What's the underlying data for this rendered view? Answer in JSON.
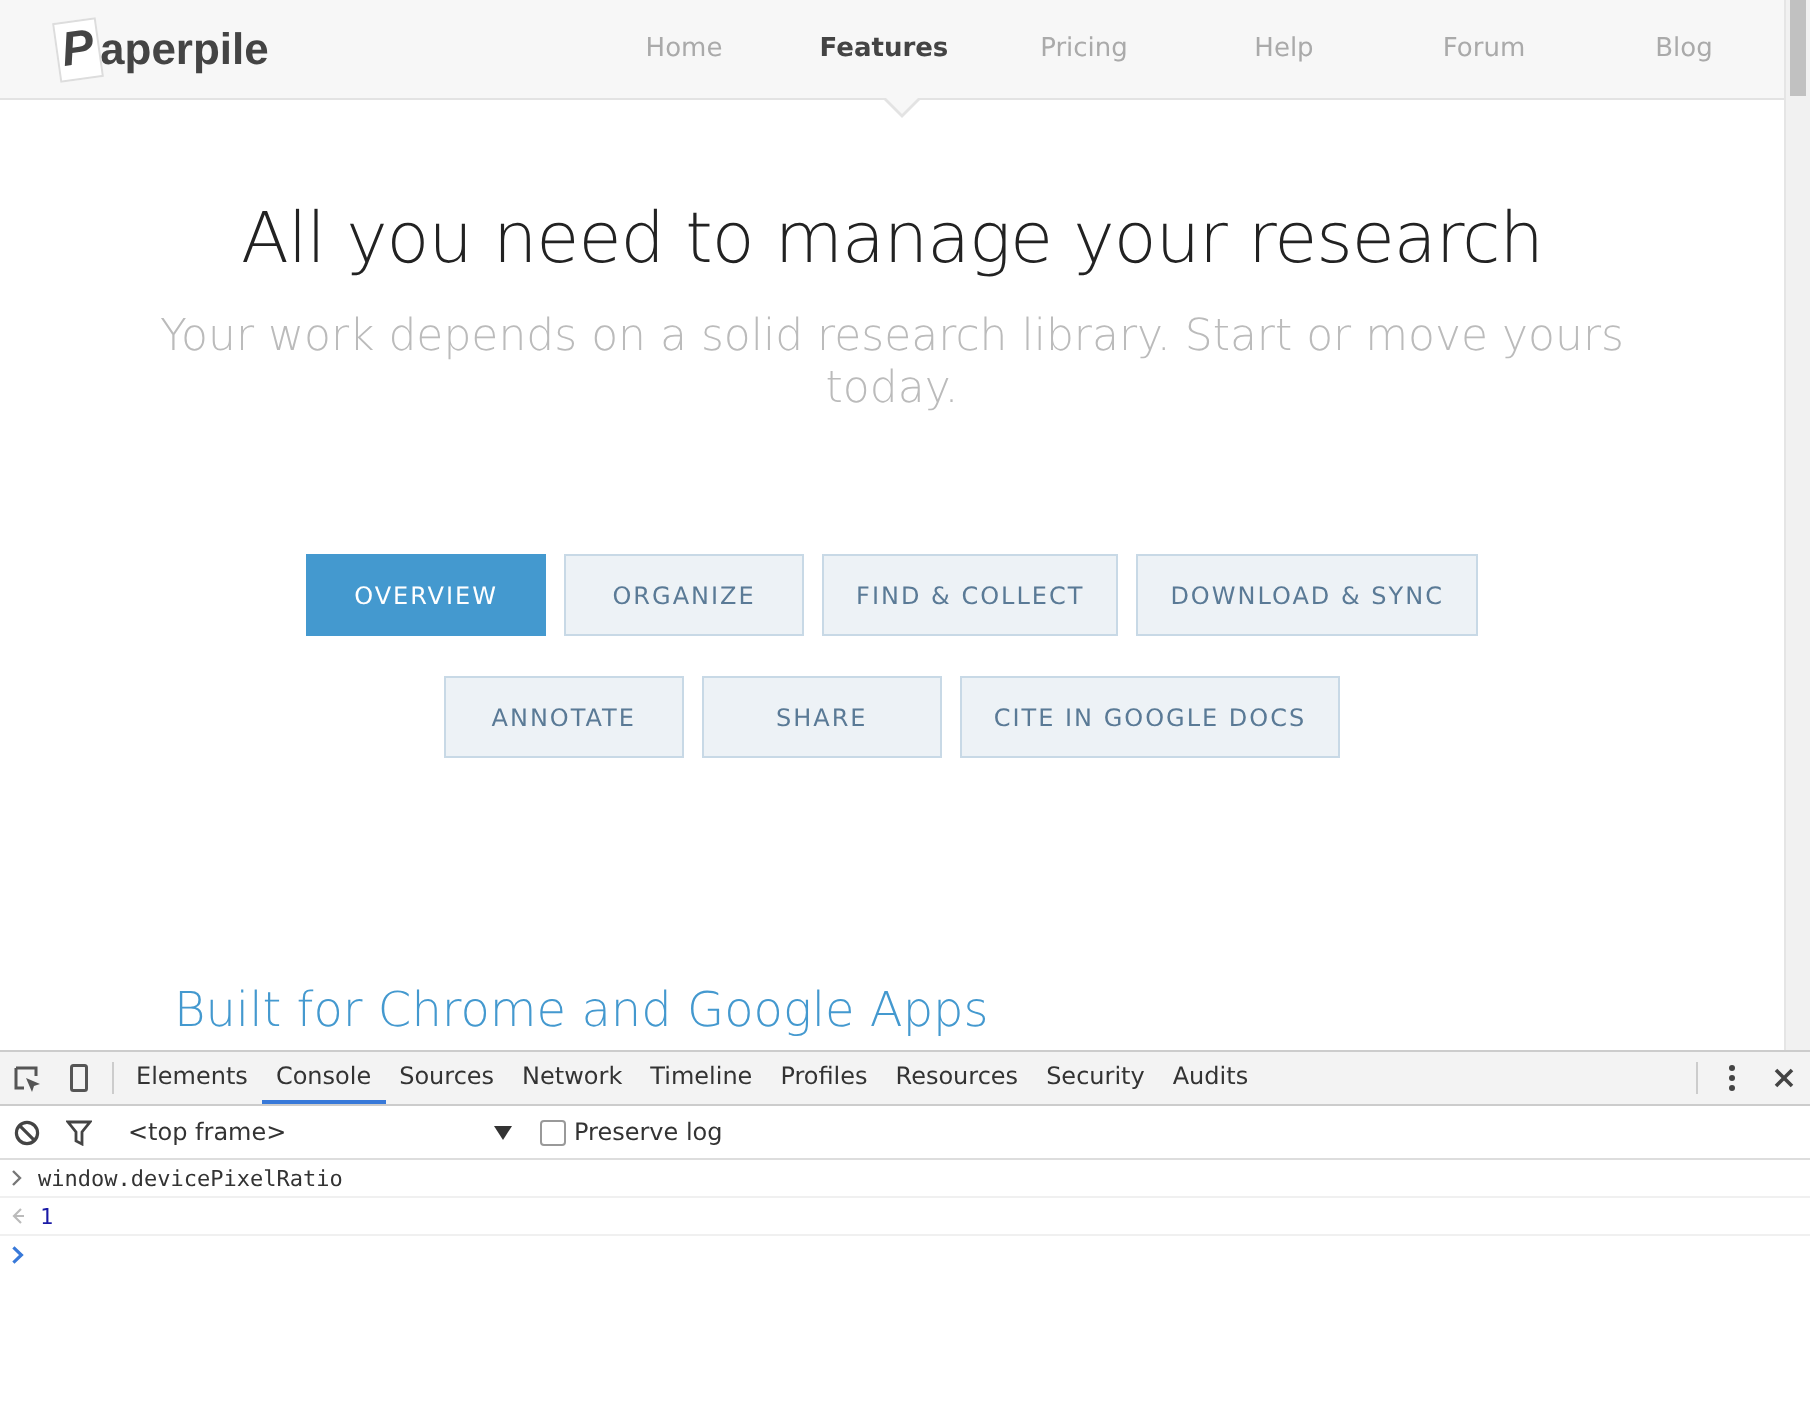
{
  "site_nav": {
    "logo": {
      "initial": "P",
      "rest": "aperpile"
    },
    "links": [
      {
        "label": "Home",
        "selected": false
      },
      {
        "label": "Features",
        "selected": true
      },
      {
        "label": "Pricing",
        "selected": false
      },
      {
        "label": "Help",
        "selected": false
      },
      {
        "label": "Forum",
        "selected": false
      },
      {
        "label": "Blog",
        "selected": false
      }
    ]
  },
  "hero": {
    "title": "All you need to manage your research",
    "subtitle": "Your work depends on a solid research library. Start or move yours today."
  },
  "feature_rows": [
    {
      "buttons": [
        {
          "label": "OVERVIEW",
          "selected": true
        },
        {
          "label": "ORGANIZE",
          "selected": false
        },
        {
          "label": "FIND & COLLECT",
          "selected": false
        },
        {
          "label": "DOWNLOAD & SYNC",
          "selected": false
        }
      ]
    },
    {
      "buttons": [
        {
          "label": "ANNOTATE",
          "selected": false
        },
        {
          "label": "SHARE",
          "selected": false
        },
        {
          "label": "CITE IN GOOGLE DOCS",
          "selected": false
        }
      ]
    }
  ],
  "section_heading": "Built for Chrome and Google Apps",
  "devtools": {
    "tabs": [
      {
        "label": "Elements",
        "selected": false
      },
      {
        "label": "Console",
        "selected": true
      },
      {
        "label": "Sources",
        "selected": false
      },
      {
        "label": "Network",
        "selected": false
      },
      {
        "label": "Timeline",
        "selected": false
      },
      {
        "label": "Profiles",
        "selected": false
      },
      {
        "label": "Resources",
        "selected": false
      },
      {
        "label": "Security",
        "selected": false
      },
      {
        "label": "Audits",
        "selected": false
      }
    ],
    "context": "<top frame>",
    "preserve_log": {
      "label": "Preserve log",
      "checked": false
    },
    "console": [
      {
        "kind": "input",
        "text": "window.devicePixelRatio"
      },
      {
        "kind": "result",
        "text": "1"
      },
      {
        "kind": "prompt"
      }
    ]
  }
}
